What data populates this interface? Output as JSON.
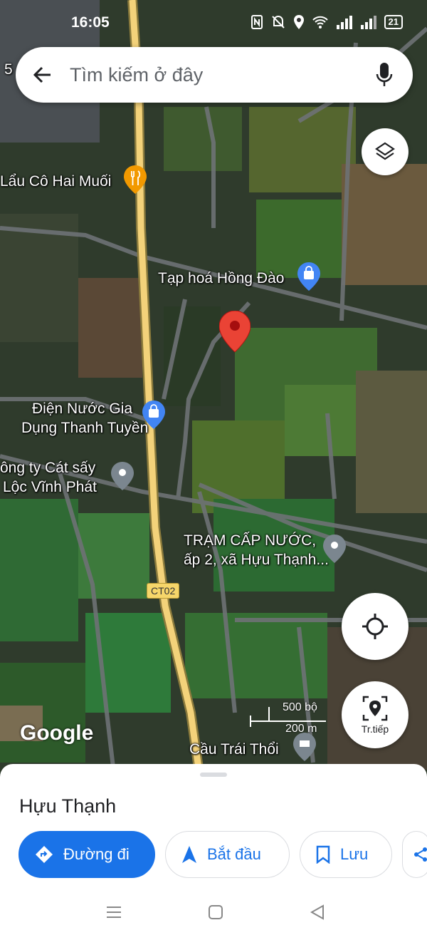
{
  "status": {
    "time": "16:05",
    "battery": "21"
  },
  "search": {
    "placeholder": "Tìm kiếm ở đây"
  },
  "map": {
    "labels": {
      "restaurant": "Lẩu Cô Hai Muối",
      "grocery": "Tạp hoá Hồng Đào",
      "appliance_line1": "Điện Nước Gia",
      "appliance_line2": "Dụng Thanh Tuyền",
      "company_line1": "ông ty Cát sấy",
      "company_line2": "Lộc Vĩnh Phát",
      "water_line1": "TRẠM CẤP NƯỚC,",
      "water_line2": "ấp 2, xã Hựu Thạnh...",
      "bridge": "Cầu Trái Thổi",
      "edge_number": "5"
    },
    "road_shield": "CT02",
    "scale": {
      "imperial": "500 bộ",
      "metric": "200 m"
    },
    "logo": "Google"
  },
  "controls": {
    "navigate_label": "Tr.tiếp"
  },
  "place": {
    "name": "Hựu Thạnh",
    "actions": {
      "directions": "Đường đi",
      "start": "Bắt đầu",
      "save": "Lưu"
    }
  },
  "colors": {
    "accent": "#1a73e8",
    "pin": "#ea4335",
    "road_major": "#f3d27a"
  }
}
